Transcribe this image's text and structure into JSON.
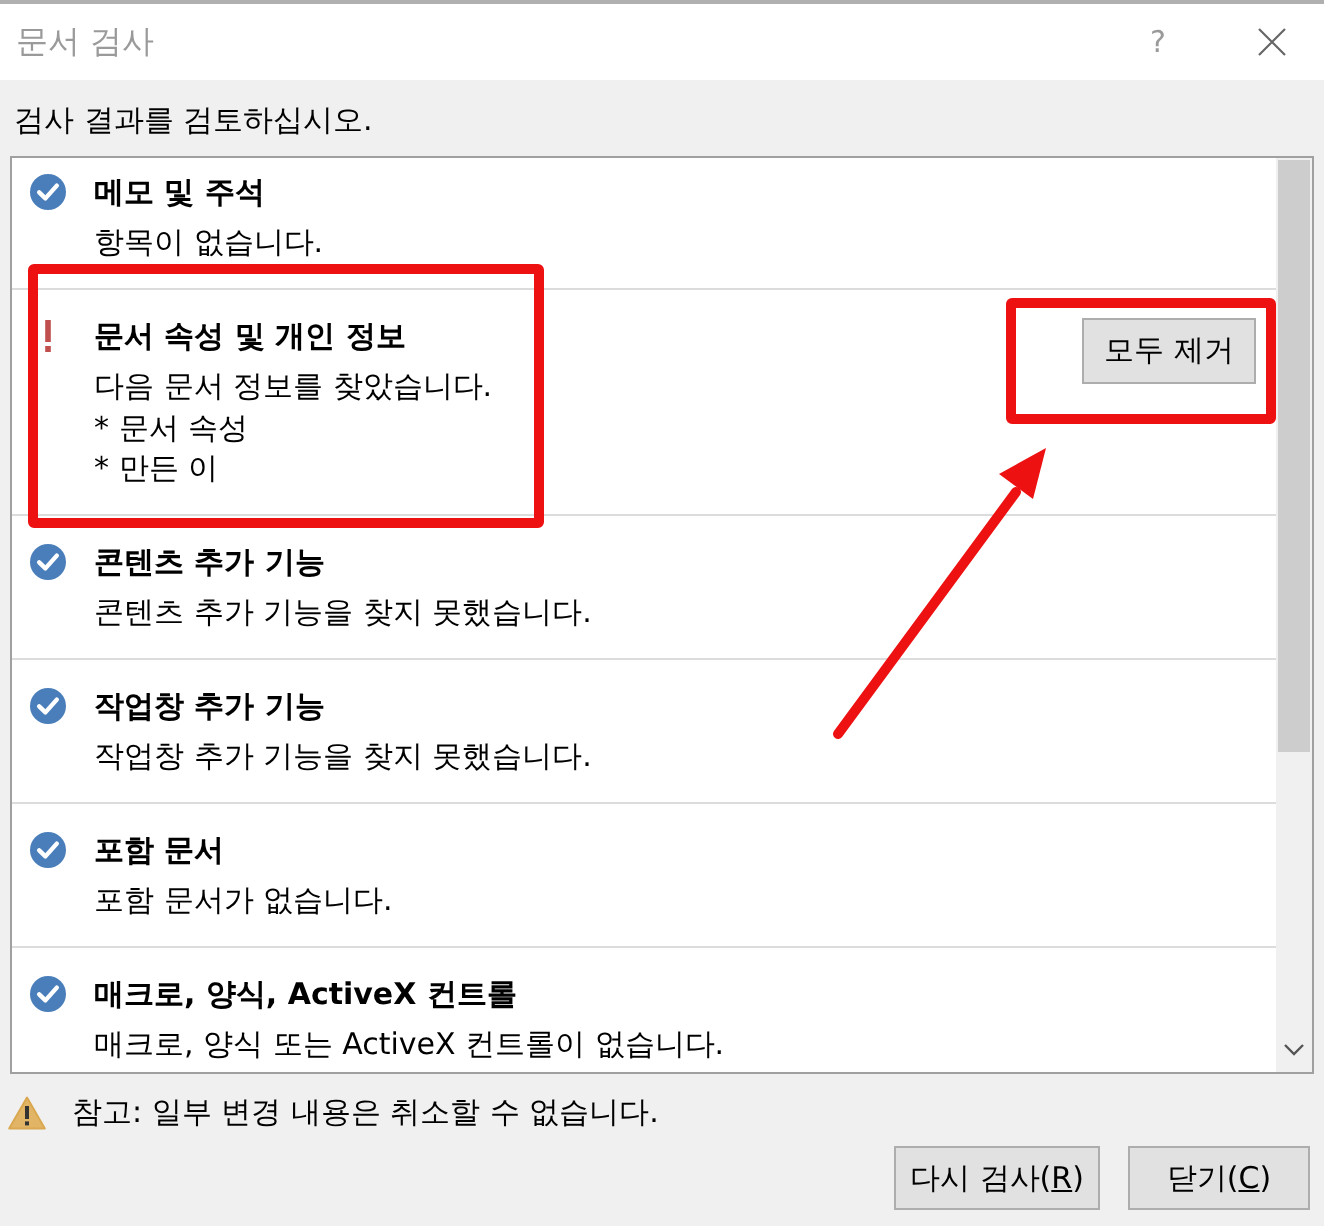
{
  "window": {
    "title": "문서 검사",
    "help": "?"
  },
  "instruction": "검사 결과를 검토하십시오.",
  "results": [
    {
      "kind": "passed",
      "title": "메모 및 주석",
      "lines": [
        "항목이 없습니다."
      ],
      "highlighted": false
    },
    {
      "kind": "found",
      "title": "문서 속성 및 개인 정보",
      "lines": [
        "다음 문서 정보를 찾았습니다.",
        "* 문서 속성",
        "* 만든 이"
      ],
      "highlighted": true,
      "action": {
        "label": "모두 제거",
        "highlighted": true,
        "arrow_pointing": true
      }
    },
    {
      "kind": "passed",
      "title": "콘텐츠 추가 기능",
      "lines": [
        "콘텐츠 추가 기능을 찾지 못했습니다."
      ],
      "highlighted": false
    },
    {
      "kind": "passed",
      "title": "작업창 추가 기능",
      "lines": [
        "작업창 추가 기능을 찾지 못했습니다."
      ],
      "highlighted": false
    },
    {
      "kind": "passed",
      "title": "포함 문서",
      "lines": [
        "포함 문서가 없습니다."
      ],
      "highlighted": false
    },
    {
      "kind": "passed",
      "title": "매크로, 양식, ActiveX 컨트롤",
      "lines": [
        "매크로, 양식 또는 ActiveX 컨트롤이 없습니다."
      ],
      "highlighted": false
    }
  ],
  "note": "참고: 일부 변경 내용은 취소할 수 없습니다.",
  "buttons": [
    {
      "before": "다시 검사(",
      "access_key": "R",
      "after": ")"
    },
    {
      "before": "닫기(",
      "access_key": "C",
      "after": ")"
    }
  ]
}
